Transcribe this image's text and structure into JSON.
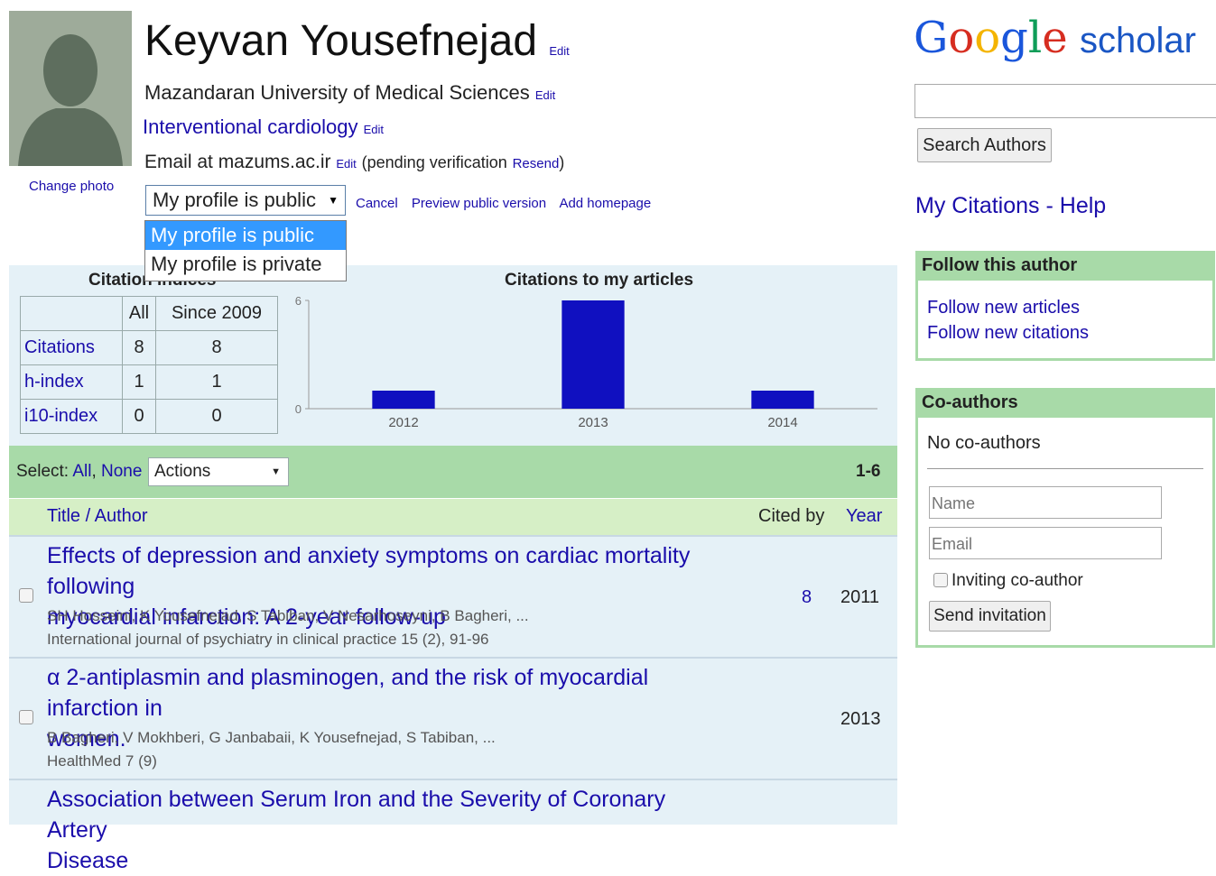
{
  "profile": {
    "name": "Keyvan Yousefnejad",
    "edit_label": "Edit",
    "affiliation": "Mazandaran University of Medical Sciences",
    "interest": "Interventional cardiology",
    "email_prefix": "Email at mazums.ac.ir",
    "pending_text": "(pending verification",
    "resend_label": "Resend",
    "pending_close": ")",
    "change_photo": "Change photo",
    "visibility_selected": "My profile is public",
    "visibility_options": [
      "My profile is public",
      "My profile is private"
    ],
    "cancel_label": "Cancel",
    "preview_label": "Preview public version",
    "homepage_label": "Add homepage"
  },
  "citation_indices": {
    "title": "Citation indices",
    "headers": [
      "",
      "All",
      "Since 2009"
    ],
    "rows": [
      {
        "label": "Citations",
        "all": "8",
        "since": "8"
      },
      {
        "label": "h-index",
        "all": "1",
        "since": "1"
      },
      {
        "label": "i10-index",
        "all": "0",
        "since": "0"
      }
    ]
  },
  "chart_data": {
    "type": "bar",
    "title": "Citations to my articles",
    "categories": [
      "2012",
      "2013",
      "2014"
    ],
    "values": [
      1,
      6,
      1
    ],
    "ylim": [
      0,
      6
    ],
    "yticks": [
      "0",
      "6"
    ],
    "color": "#1010c0"
  },
  "list": {
    "select_label": "Select:",
    "all_label": "All",
    "none_label": "None",
    "actions_label": "Actions",
    "range": "1-6",
    "col_title": "Title / Author",
    "col_cited": "Cited by",
    "col_year": "Year",
    "articles": [
      {
        "title_line1": "Effects of depression and anxiety symptoms on cardiac mortality following",
        "title_line2": "myocardial infarction: A 2-year follow-up",
        "authors": "SH Hosseini, K Yousefnejad, S Tabiban, V Nesarhoseyni, B Bagheri, ...",
        "source": "International journal of psychiatry in clinical practice 15 (2), 91-96",
        "cited_by": "8",
        "year": "2011"
      },
      {
        "title_line1": "α 2-antiplasmin and plasminogen, and the risk of myocardial infarction in",
        "title_line2": "women.",
        "authors": "B Bagheri, V Mokhberi, G Janbabaii, K Yousefnejad, S Tabiban, ...",
        "source": "HealthMed 7 (9)",
        "cited_by": "",
        "year": "2013"
      },
      {
        "title_line1": "Association between Serum Iron and the Severity of Coronary Artery",
        "title_line2": "Disease",
        "authors": "",
        "source": "",
        "cited_by": "",
        "year": ""
      }
    ]
  },
  "sidebar": {
    "logo_text": "Google",
    "logo_scholar": "scholar",
    "search_value": "",
    "search_button": "Search Authors",
    "my_citations": "My Citations",
    "separator": " - ",
    "help": "Help",
    "follow_title": "Follow this author",
    "follow_articles": "Follow new articles",
    "follow_citations": "Follow new citations",
    "coauthors_title": "Co-authors",
    "no_coauthors": "No co-authors",
    "name_placeholder": "Name",
    "email_placeholder": "Email",
    "inviting_label": "Inviting co-author",
    "send_invitation": "Send invitation"
  },
  "colors": {
    "link": "#1a0dab",
    "green_bar": "#a8daa8",
    "panel": "#e5f1f7",
    "header_row": "#d6efc6"
  }
}
